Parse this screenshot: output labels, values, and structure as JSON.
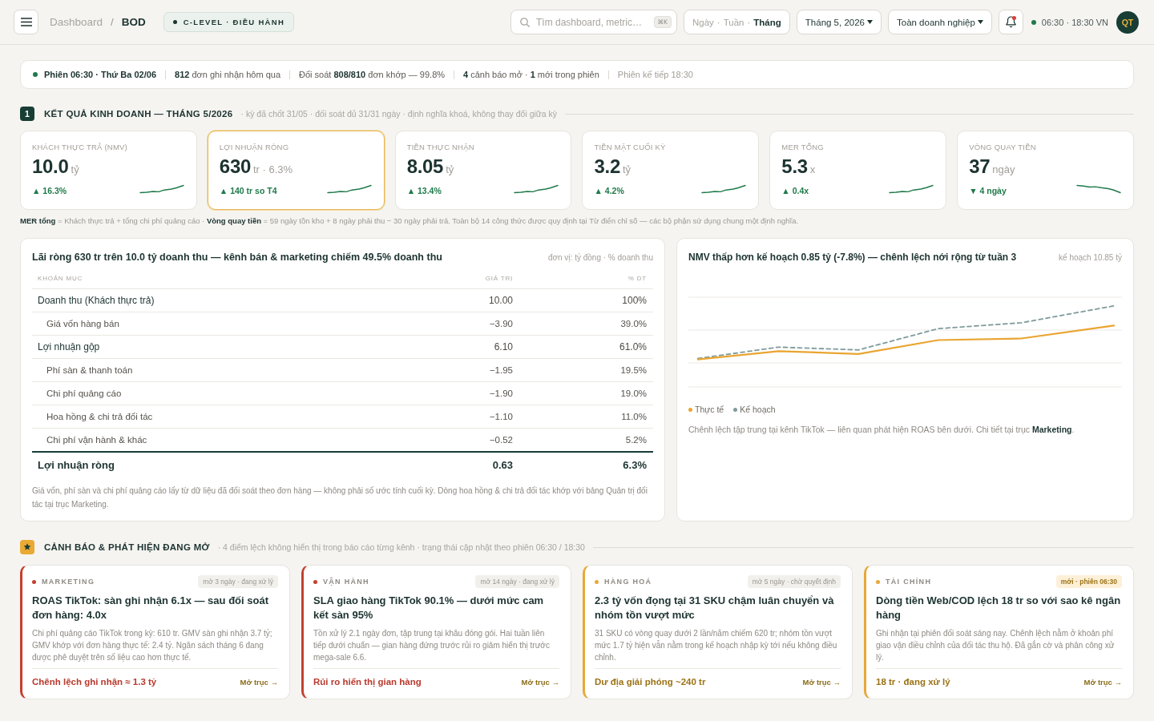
{
  "header": {
    "breadcrumb": [
      {
        "label": "Dashboard",
        "current": false
      },
      {
        "label": "BOD",
        "current": true
      }
    ],
    "breadcrumb_separator": "/",
    "role_badge": "C-LEVEL · ĐIỀU HÀNH",
    "search": {
      "placeholder": "Tìm dashboard, metric…",
      "shortcut": "⌘K"
    },
    "period": {
      "separator": "·",
      "options": [
        {
          "label": "Ngày",
          "selected": false
        },
        {
          "label": "Tuần",
          "selected": false
        },
        {
          "label": "Tháng",
          "selected": true
        }
      ]
    },
    "filters": [
      {
        "label": "Tháng 5, 2026"
      },
      {
        "label": "Toàn doanh nghiệp"
      }
    ],
    "notifications": {
      "unread": true
    },
    "session_clock": {
      "label": "06:30 · 18:30 VN",
      "live": true
    },
    "avatar": "QT"
  },
  "session_bar": [
    {
      "kind": "session",
      "text": "Phiên 06:30 · Thứ Ba 02/06"
    },
    {
      "kind": "stat",
      "text": "**812** đơn ghi nhận hôm qua"
    },
    {
      "kind": "stat",
      "text": "Đối soát **808/810** đơn khớp — 99.8%"
    },
    {
      "kind": "stat",
      "text": "**4** cảnh báo mở · **1** mới trong phiên"
    },
    {
      "kind": "muted",
      "text": "Phiên kế tiếp 18:30"
    }
  ],
  "results": {
    "badge": {
      "kind": "number",
      "text": "1"
    },
    "title": "KẾT QUẢ KINH DOANH — THÁNG 5/2026",
    "subtitle": "· kỳ đã chốt 31/05 · đối soát đủ 31/31 ngày · định nghĩa khoá, không thay đổi giữa kỳ",
    "kpis": [
      {
        "label": "KHÁCH THỰC TRẢ (NMV)",
        "value": "10.0",
        "unit": "tỷ",
        "change": "▲ 16.3%",
        "falling": false,
        "highlighted": false
      },
      {
        "label": "LỢI NHUẬN RÒNG",
        "value": "630",
        "unit": "tr · 6.3%",
        "change": "▲ 140 tr so T4",
        "falling": false,
        "highlighted": true
      },
      {
        "label": "TIỀN THỰC NHẬN",
        "value": "8.05",
        "unit": "tỷ",
        "change": "▲ 13.4%",
        "falling": false,
        "highlighted": false
      },
      {
        "label": "TIỀN MẶT CUỐI KỲ",
        "value": "3.2",
        "unit": "tỷ",
        "change": "▲ 4.2%",
        "falling": false,
        "highlighted": false
      },
      {
        "label": "MER TỔNG",
        "value": "5.3",
        "unit": "x",
        "change": "▲ 0.4x",
        "falling": false,
        "highlighted": false
      },
      {
        "label": "VÒNG QUAY TIỀN",
        "value": "37",
        "unit": "ngày",
        "change": "▼ 4 ngày",
        "falling": true,
        "highlighted": false
      }
    ],
    "footnote": "**MER tổng** = Khách thực trả + tổng chi phí quảng cáo · **Vòng quay tiền** = 59 ngày tồn kho + 8 ngày phải thu − 30 ngày phải trả. Toàn bộ 14 công thức được quy định tại Từ điển chỉ số — các bộ phận sử dụng chung một định nghĩa."
  },
  "pnl": {
    "title": "Lãi ròng 630 tr trên 10.0 tỷ doanh thu — kênh bán & marketing chiếm 49.5% doanh thu",
    "unit": "đơn vị: tỷ đồng · % doanh thu",
    "columns": [
      "KHOẢN MỤC",
      "GIÁ TRỊ",
      "% DT"
    ],
    "rows": [
      {
        "label": "Doanh thu (Khách thực trả)",
        "value": "10.00",
        "percent": "100%",
        "children": [
          {
            "label": "Giá vốn hàng bán",
            "value": "−3.90",
            "percent": "39.0%"
          }
        ]
      },
      {
        "label": "Lợi nhuận gộp",
        "value": "6.10",
        "percent": "61.0%",
        "children": [
          {
            "label": "Phí sàn & thanh toán",
            "value": "−1.95",
            "percent": "19.5%"
          },
          {
            "label": "Chi phí quảng cáo",
            "value": "−1.90",
            "percent": "19.0%"
          },
          {
            "label": "Hoa hồng & chi trả đối tác",
            "value": "−1.10",
            "percent": "11.0%"
          },
          {
            "label": "Chi phí vận hành & khác",
            "value": "−0.52",
            "percent": "5.2%"
          }
        ]
      }
    ],
    "total": {
      "label": "Lợi nhuận ròng",
      "value": "0.63",
      "percent": "6.3%"
    },
    "footnote": "Giá vốn, phí sàn và chi phí quảng cáo lấy từ dữ liệu đã đối soát theo đơn hàng — không phải số ước tính cuối kỳ. Dòng hoa hồng & chi trả đối tác khớp với bảng Quản trị đối tác tại trục Marketing."
  },
  "nmv_chart": {
    "title": "NMV thấp hơn kế hoạch 0.85 tỷ (-7.8%) — chênh lệch nới rộng từ tuần 3",
    "plan_note": "kế hoạch 10.85 tỷ",
    "legend": [
      {
        "label": "Thực tế",
        "color": "#e9a531",
        "dashed": false
      },
      {
        "label": "Kế hoạch",
        "color": "#7f9b9b",
        "dashed": true
      }
    ],
    "note": "Chênh lệch tập trung tại kênh TikTok — liên quan phát hiện ROAS bên dưới. Chi tiết tại trục **Marketing**."
  },
  "alerts": {
    "badge": {
      "kind": "star"
    },
    "title": "CẢNH BÁO & PHÁT HIỆN ĐANG MỞ",
    "subtitle": "· 4 điểm lệch không hiển thị trong báo cáo từng kênh · trạng thái cập nhật theo phiên 06:30 / 18:30",
    "items": [
      {
        "critical": true,
        "category": "MARKETING",
        "status": "mở 3 ngày · đang xử lý",
        "new": false,
        "title": "ROAS TikTok: sàn ghi nhận 6.1x — sau đối soát đơn hàng: 4.0x",
        "body": "Chi phí quảng cáo TikTok trong kỳ: 610 tr. GMV sàn ghi nhận 3.7 tỷ; GMV khớp với đơn hàng thực tế: 2.4 tỷ. Ngân sách tháng 6 đang được phê duyệt trên số liệu cao hơn thực tế.",
        "impact": "Chênh lệch ghi nhận ≈ 1.3 tỷ",
        "link": "Mở trục →"
      },
      {
        "critical": true,
        "category": "VẬN HÀNH",
        "status": "mở 14 ngày · đang xử lý",
        "new": false,
        "title": "SLA giao hàng TikTok 90.1% — dưới mức cam kết sàn 95%",
        "body": "Tồn xử lý 2.1 ngày đơn, tập trung tại khâu đóng gói. Hai tuần liên tiếp dưới chuẩn — gian hàng đứng trước rủi ro giảm hiển thị trước mega-sale 6.6.",
        "impact": "Rủi ro hiển thị gian hàng",
        "link": "Mở trục →"
      },
      {
        "critical": false,
        "category": "HÀNG HOÁ",
        "status": "mở 5 ngày · chờ quyết định",
        "new": false,
        "title": "2.3 tỷ vốn đọng tại 31 SKU chậm luân chuyển và nhóm tồn vượt mức",
        "body": "31 SKU có vòng quay dưới 2 lần/năm chiếm 620 tr; nhóm tồn vượt mức 1.7 tỷ hiện vẫn nằm trong kế hoạch nhập kỳ tới nếu không điều chỉnh.",
        "impact": "Dư địa giải phóng ~240 tr",
        "link": "Mở trục →"
      },
      {
        "critical": false,
        "category": "TÀI CHÍNH",
        "status": "mới · phiên 06:30",
        "new": true,
        "title": "Dòng tiền Web/COD lệch 18 tr so với sao kê ngân hàng",
        "body": "Ghi nhận tại phiên đối soát sáng nay. Chênh lệch nằm ở khoản phí giao vận điều chỉnh của đối tác thu hộ. Đã gắn cờ và phân công xử lý.",
        "impact": "18 tr · đang xử lý",
        "link": "Mở trục →"
      }
    ]
  }
}
